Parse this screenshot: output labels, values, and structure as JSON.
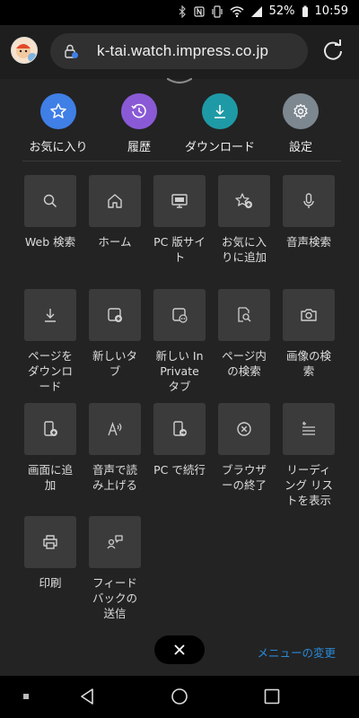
{
  "status": {
    "battery": "52%",
    "time": "10:59"
  },
  "address": {
    "url": "k-tai.watch.impress.co.jp"
  },
  "quick_actions": [
    {
      "label": "お気に入り",
      "icon": "star-icon",
      "color": "#3f7fe6"
    },
    {
      "label": "履歴",
      "icon": "history-icon",
      "color": "#8a5ad6"
    },
    {
      "label": "ダウンロード",
      "icon": "download-icon",
      "color": "#1e9aa6"
    },
    {
      "label": "設定",
      "icon": "gear-icon",
      "color": "#7d8790"
    }
  ],
  "tiles": [
    {
      "label": "Web 検索",
      "icon": "search-icon"
    },
    {
      "label": "ホーム",
      "icon": "home-icon"
    },
    {
      "label": "PC 版サイト",
      "icon": "desktop-icon"
    },
    {
      "label": "お気に入りに追加",
      "icon": "star-add-icon"
    },
    {
      "label": "音声検索",
      "icon": "microphone-icon"
    },
    {
      "label": "ページをダウンロード",
      "icon": "download-icon"
    },
    {
      "label": "新しいタブ",
      "icon": "new-tab-icon"
    },
    {
      "label": "新しい InPrivate タブ",
      "icon": "inprivate-tab-icon"
    },
    {
      "label": "ページ内の検索",
      "icon": "find-in-page-icon"
    },
    {
      "label": "画像の検索",
      "icon": "camera-icon"
    },
    {
      "label": "画面に追加",
      "icon": "add-to-screen-icon"
    },
    {
      "label": "音声で読み上げる",
      "icon": "read-aloud-icon"
    },
    {
      "label": "PC で続行",
      "icon": "continue-on-pc-icon"
    },
    {
      "label": "ブラウザーの終了",
      "icon": "close-browser-icon"
    },
    {
      "label": "リーディング リストを表示",
      "icon": "reading-list-icon"
    },
    {
      "label": "印刷",
      "icon": "print-icon"
    },
    {
      "label": "フィードバックの送信",
      "icon": "feedback-icon"
    }
  ],
  "footer": {
    "change_menu": "メニューの変更"
  }
}
